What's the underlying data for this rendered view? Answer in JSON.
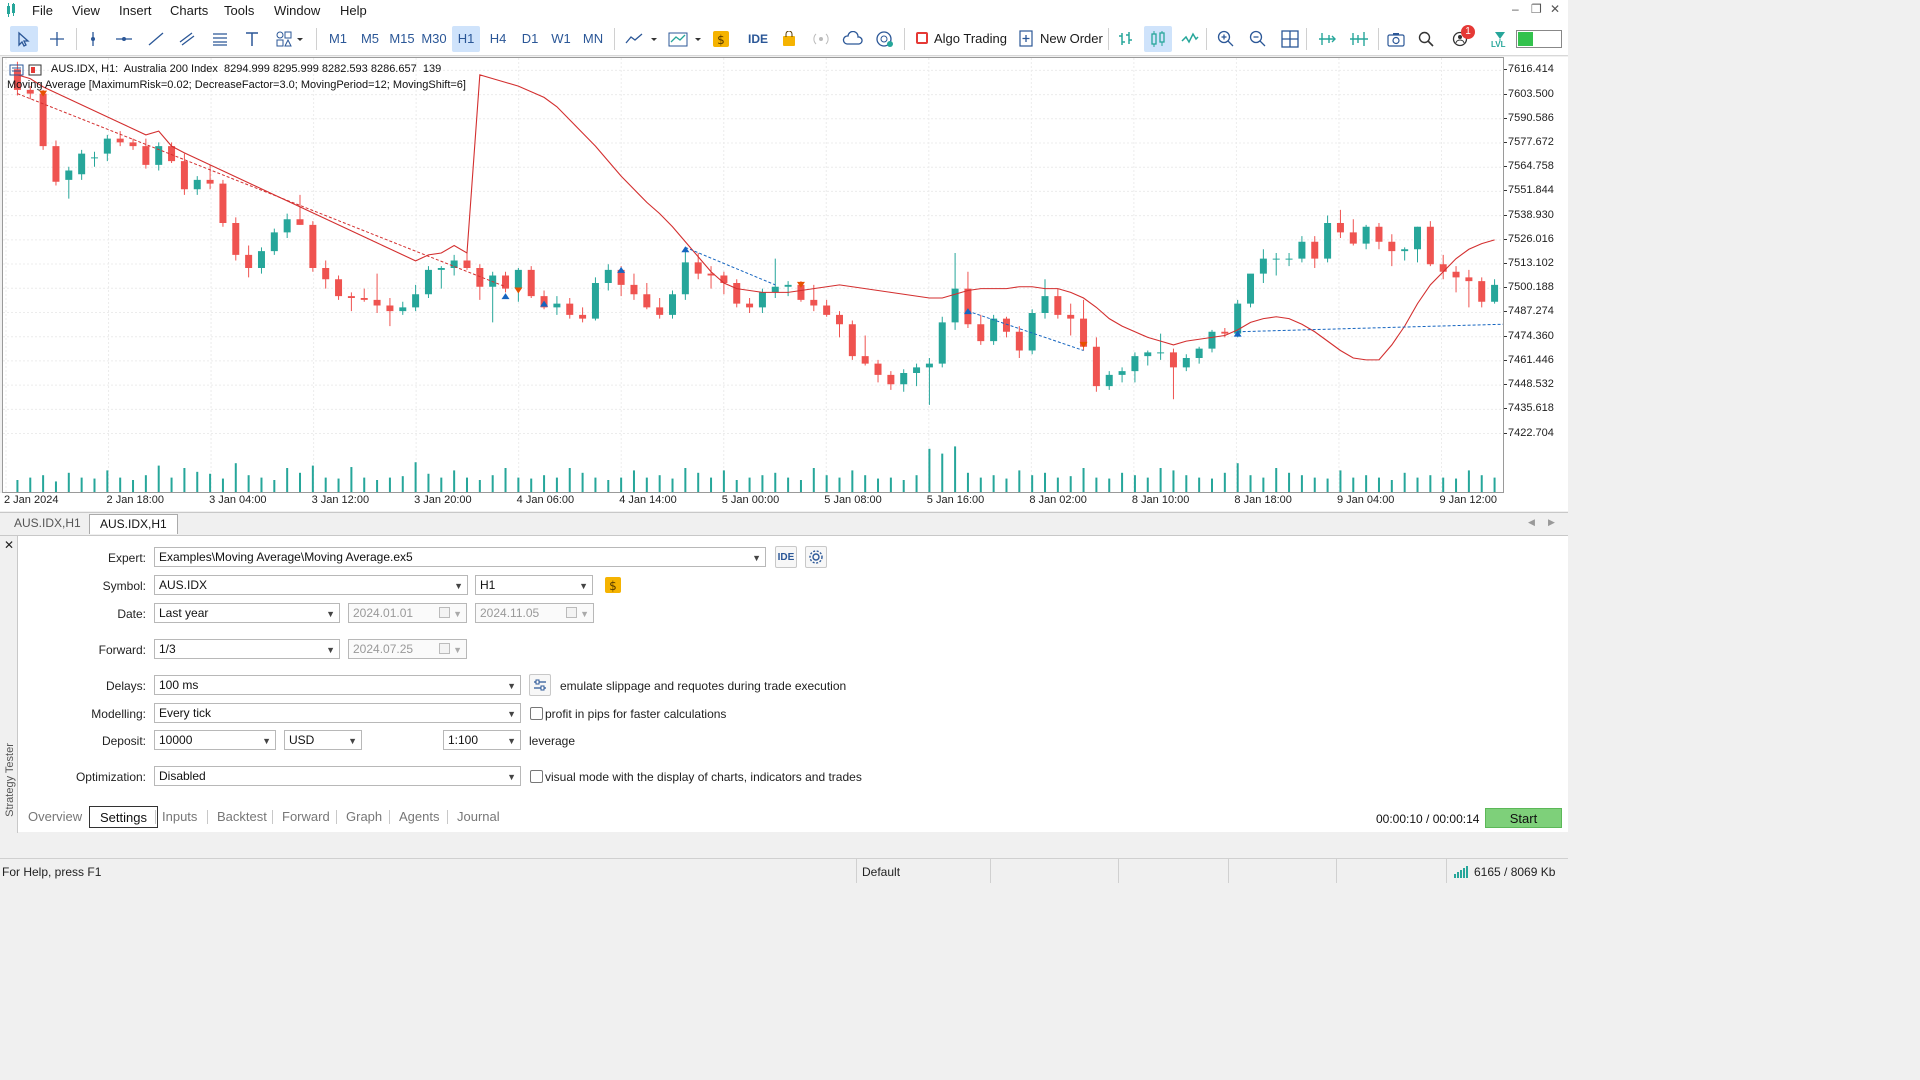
{
  "menu": {
    "items": [
      "File",
      "Insert",
      "Charts",
      "Tools",
      "Window",
      "Help"
    ],
    "view": "View"
  },
  "toolbar": {
    "timeframes": [
      "M1",
      "M5",
      "M15",
      "M30",
      "H1",
      "H4",
      "D1",
      "W1",
      "MN"
    ],
    "selected_timeframe": "H1",
    "ide_label": "IDE",
    "algo_trading_label": "Algo Trading",
    "new_order_label": "New Order",
    "notification_count": "1",
    "level_label": "LVL"
  },
  "chart": {
    "header_line1": "AUS.IDX, H1:  Australia 200 Index  8294.999 8295.999 8282.593 8286.657  139",
    "header_line2": "Moving Average [MaximumRisk=0.02; DecreaseFactor=3.0; MovingPeriod=12; MovingShift=6]",
    "bull_color": "#26a69a",
    "bear_color": "#ef5350",
    "ma_color": "#d32f2f"
  },
  "chart_data": {
    "type": "candlestick",
    "symbol": "AUS.IDX",
    "timeframe": "H1",
    "price_ticks": [
      7616.414,
      7603.5,
      7590.586,
      7577.672,
      7564.758,
      7551.844,
      7538.93,
      7526.016,
      7513.102,
      7500.188,
      7487.274,
      7474.36,
      7461.446,
      7448.532,
      7435.618,
      7422.704
    ],
    "time_ticks": [
      "2 Jan 2024",
      "2 Jan 18:00",
      "3 Jan 04:00",
      "3 Jan 12:00",
      "3 Jan 20:00",
      "4 Jan 06:00",
      "4 Jan 14:00",
      "5 Jan 00:00",
      "5 Jan 08:00",
      "5 Jan 16:00",
      "8 Jan 02:00",
      "8 Jan 10:00",
      "8 Jan 18:00",
      "9 Jan 04:00",
      "9 Jan 12:00"
    ],
    "ylim": [
      7415,
      7623
    ],
    "candles": [
      [
        7617,
        7621,
        7603,
        7606
      ],
      [
        7606,
        7608,
        7601,
        7604
      ],
      [
        7604,
        7606,
        7574,
        7576
      ],
      [
        7576,
        7579,
        7555,
        7557
      ],
      [
        7558,
        7565,
        7548,
        7563
      ],
      [
        7561,
        7574,
        7558,
        7572
      ],
      [
        7570,
        7573,
        7565,
        7570
      ],
      [
        7572,
        7582,
        7568,
        7580
      ],
      [
        7580,
        7584,
        7576,
        7578
      ],
      [
        7578,
        7580,
        7574,
        7576
      ],
      [
        7576,
        7580,
        7564,
        7566
      ],
      [
        7566,
        7578,
        7563,
        7576
      ],
      [
        7576,
        7578,
        7567,
        7568
      ],
      [
        7568,
        7572,
        7550,
        7553
      ],
      [
        7553,
        7560,
        7550,
        7558
      ],
      [
        7558,
        7566,
        7553,
        7556
      ],
      [
        7556,
        7558,
        7533,
        7535
      ],
      [
        7535,
        7538,
        7515,
        7518
      ],
      [
        7518,
        7523,
        7506,
        7511
      ],
      [
        7511,
        7522,
        7508,
        7520
      ],
      [
        7520,
        7532,
        7518,
        7530
      ],
      [
        7530,
        7540,
        7527,
        7537
      ],
      [
        7537,
        7550,
        7534,
        7534
      ],
      [
        7534,
        7536,
        7509,
        7511
      ],
      [
        7511,
        7515,
        7500,
        7505
      ],
      [
        7505,
        7507,
        7494,
        7496
      ],
      [
        7496,
        7498,
        7488,
        7495
      ],
      [
        7495,
        7500,
        7493,
        7494
      ],
      [
        7494,
        7508,
        7487,
        7491
      ],
      [
        7491,
        7495,
        7480,
        7488
      ],
      [
        7488,
        7493,
        7486,
        7490
      ],
      [
        7490,
        7502,
        7488,
        7497
      ],
      [
        7497,
        7512,
        7495,
        7510
      ],
      [
        7510,
        7512,
        7500,
        7511
      ],
      [
        7511,
        7518,
        7507,
        7515
      ],
      [
        7515,
        7519,
        7510,
        7511
      ],
      [
        7511,
        7513,
        7494,
        7501
      ],
      [
        7501,
        7509,
        7482,
        7507
      ],
      [
        7507,
        7509,
        7498,
        7500
      ],
      [
        7500,
        7511,
        7493,
        7510
      ],
      [
        7510,
        7512,
        7495,
        7496
      ],
      [
        7496,
        7499,
        7489,
        7490
      ],
      [
        7490,
        7496,
        7486,
        7492
      ],
      [
        7492,
        7495,
        7484,
        7486
      ],
      [
        7486,
        7490,
        7482,
        7484
      ],
      [
        7484,
        7506,
        7483,
        7503
      ],
      [
        7503,
        7513,
        7499,
        7510
      ],
      [
        7510,
        7512,
        7496,
        7502
      ],
      [
        7502,
        7508,
        7494,
        7497
      ],
      [
        7497,
        7503,
        7489,
        7490
      ],
      [
        7490,
        7495,
        7484,
        7486
      ],
      [
        7486,
        7499,
        7484,
        7497
      ],
      [
        7497,
        7521,
        7494,
        7514
      ],
      [
        7514,
        7519,
        7505,
        7508
      ],
      [
        7508,
        7512,
        7500,
        7507
      ],
      [
        7507,
        7509,
        7497,
        7503
      ],
      [
        7503,
        7505,
        7490,
        7492
      ],
      [
        7492,
        7495,
        7487,
        7490
      ],
      [
        7490,
        7500,
        7487,
        7498
      ],
      [
        7498,
        7516,
        7495,
        7501
      ],
      [
        7501,
        7504,
        7496,
        7502
      ],
      [
        7502,
        7504,
        7493,
        7494
      ],
      [
        7494,
        7502,
        7488,
        7491
      ],
      [
        7491,
        7494,
        7485,
        7486
      ],
      [
        7486,
        7488,
        7474,
        7481
      ],
      [
        7481,
        7483,
        7462,
        7464
      ],
      [
        7464,
        7475,
        7459,
        7460
      ],
      [
        7460,
        7462,
        7450,
        7454
      ],
      [
        7454,
        7456,
        7446,
        7449
      ],
      [
        7449,
        7457,
        7445,
        7455
      ],
      [
        7455,
        7460,
        7448,
        7458
      ],
      [
        7458,
        7463,
        7438,
        7460
      ],
      [
        7460,
        7485,
        7458,
        7482
      ],
      [
        7482,
        7519,
        7478,
        7500
      ],
      [
        7500,
        7509,
        7479,
        7481
      ],
      [
        7481,
        7486,
        7470,
        7472
      ],
      [
        7472,
        7486,
        7470,
        7484
      ],
      [
        7484,
        7485,
        7474,
        7477
      ],
      [
        7477,
        7480,
        7463,
        7467
      ],
      [
        7467,
        7489,
        7465,
        7487
      ],
      [
        7487,
        7505,
        7484,
        7496
      ],
      [
        7496,
        7500,
        7484,
        7486
      ],
      [
        7486,
        7492,
        7475,
        7484
      ],
      [
        7484,
        7494,
        7467,
        7469
      ],
      [
        7469,
        7474,
        7445,
        7448
      ],
      [
        7448,
        7456,
        7446,
        7454
      ],
      [
        7454,
        7458,
        7450,
        7456
      ],
      [
        7456,
        7466,
        7450,
        7464
      ],
      [
        7464,
        7467,
        7459,
        7466
      ],
      [
        7466,
        7476,
        7462,
        7466
      ],
      [
        7466,
        7468,
        7441,
        7458
      ],
      [
        7458,
        7465,
        7456,
        7463
      ],
      [
        7463,
        7469,
        7460,
        7468
      ],
      [
        7468,
        7478,
        7466,
        7477
      ],
      [
        7477,
        7479,
        7474,
        7476
      ],
      [
        7476,
        7494,
        7474,
        7492
      ],
      [
        7492,
        7507,
        7490,
        7508
      ],
      [
        7508,
        7521,
        7503,
        7516
      ],
      [
        7516,
        7519,
        7507,
        7516
      ],
      [
        7516,
        7519,
        7512,
        7516
      ],
      [
        7516,
        7528,
        7514,
        7525
      ],
      [
        7525,
        7528,
        7511,
        7516
      ],
      [
        7516,
        7539,
        7514,
        7535
      ],
      [
        7535,
        7542,
        7527,
        7530
      ],
      [
        7530,
        7537,
        7523,
        7524
      ],
      [
        7524,
        7534,
        7521,
        7533
      ],
      [
        7533,
        7535,
        7521,
        7525
      ],
      [
        7525,
        7529,
        7512,
        7520
      ],
      [
        7520,
        7522,
        7515,
        7521
      ],
      [
        7521,
        7533,
        7514,
        7533
      ],
      [
        7533,
        7536,
        7512,
        7513
      ],
      [
        7513,
        7518,
        7505,
        7509
      ],
      [
        7509,
        7512,
        7498,
        7506
      ],
      [
        7506,
        7510,
        7490,
        7504
      ],
      [
        7504,
        7506,
        7490,
        7493
      ],
      [
        7493,
        7505,
        7492,
        7502
      ]
    ],
    "ma": [
      7614,
      7612,
      7610,
      7608,
      7605,
      7602,
      7597,
      7590,
      7583,
      7576,
      7568,
      7560,
      7553,
      7546,
      7540,
      7533,
      7525,
      7517,
      7509,
      7503,
      7500,
      7499,
      7498,
      7498,
      7498,
      7499,
      7500,
      7501,
      7502,
      7501,
      7500,
      7499,
      7498,
      7497,
      7496,
      7495,
      7495,
      7497,
      7499,
      7500,
      7500,
      7500,
      7501,
      7501,
      7500,
      7500,
      7498,
      7495,
      7490,
      7484,
      7480,
      7477,
      7474,
      7472,
      7470,
      7472,
      7473,
      7474,
      7475,
      7478,
      7482,
      7484,
      7485,
      7484,
      7481,
      7477,
      7472,
      7467,
      7463,
      7462,
      7462,
      7470,
      7480,
      7492,
      7502,
      7509,
      7516,
      7521,
      7524,
      7526,
      7526
    ],
    "ma_start_index": 36,
    "volumes": [
      0.25,
      0.3,
      0.35,
      0.22,
      0.4,
      0.3,
      0.28,
      0.45,
      0.3,
      0.25,
      0.35,
      0.55,
      0.3,
      0.5,
      0.42,
      0.38,
      0.28,
      0.6,
      0.35,
      0.3,
      0.25,
      0.5,
      0.4,
      0.55,
      0.3,
      0.28,
      0.52,
      0.3,
      0.25,
      0.3,
      0.33,
      0.62,
      0.38,
      0.3,
      0.45,
      0.3,
      0.25,
      0.35,
      0.5,
      0.3,
      0.28,
      0.35,
      0.3,
      0.5,
      0.4,
      0.3,
      0.25,
      0.3,
      0.45,
      0.3,
      0.35,
      0.28,
      0.5,
      0.4,
      0.3,
      0.45,
      0.25,
      0.3,
      0.35,
      0.4,
      0.3,
      0.25,
      0.5,
      0.35,
      0.3,
      0.45,
      0.35,
      0.28,
      0.3,
      0.25,
      0.35,
      0.9,
      0.8,
      0.95,
      0.4,
      0.3,
      0.35,
      0.28,
      0.45,
      0.35,
      0.4,
      0.3,
      0.33,
      0.5,
      0.3,
      0.28,
      0.4,
      0.35,
      0.3,
      0.5,
      0.45,
      0.35,
      0.3,
      0.28,
      0.4,
      0.6,
      0.35,
      0.3,
      0.5,
      0.4,
      0.35,
      0.3,
      0.28,
      0.45,
      0.3,
      0.35,
      0.3,
      0.25,
      0.4,
      0.3,
      0.35,
      0.3,
      0.28,
      0.45,
      0.35,
      0.3
    ]
  },
  "chart_tabs": [
    "AUS.IDX,H1",
    "AUS.IDX,H1"
  ],
  "tester": {
    "panel_title": "Strategy Tester",
    "expert": {
      "label": "Expert:",
      "value": "Examples\\Moving Average\\Moving Average.ex5"
    },
    "symbol": {
      "label": "Symbol:",
      "value": "AUS.IDX",
      "timeframe": "H1"
    },
    "date": {
      "label": "Date:",
      "value": "Last year",
      "from": "2024.01.01",
      "to": "2024.11.05"
    },
    "forward": {
      "label": "Forward:",
      "value": "1/3",
      "date": "2024.07.25"
    },
    "delays": {
      "label": "Delays:",
      "value": "100 ms",
      "hint": "emulate slippage and requotes during trade execution"
    },
    "modelling": {
      "label": "Modelling:",
      "value": "Every tick",
      "checkbox": "profit in pips for faster calculations"
    },
    "deposit": {
      "label": "Deposit:",
      "value": "10000",
      "currency": "USD",
      "leverage_value": "1:100",
      "leverage_label": "leverage"
    },
    "optimization": {
      "label": "Optimization:",
      "value": "Disabled",
      "checkbox": "visual mode with the display of charts, indicators and trades"
    },
    "tabs": [
      "Overview",
      "Settings",
      "Inputs",
      "Backtest",
      "Forward",
      "Graph",
      "Agents",
      "Journal"
    ],
    "active_tab": "Settings",
    "timer": "00:00:10 / 00:00:14",
    "start_label": "Start"
  },
  "status": {
    "help": "For Help, press F1",
    "profile": "Default",
    "traffic": "6165 / 8069 Kb"
  }
}
